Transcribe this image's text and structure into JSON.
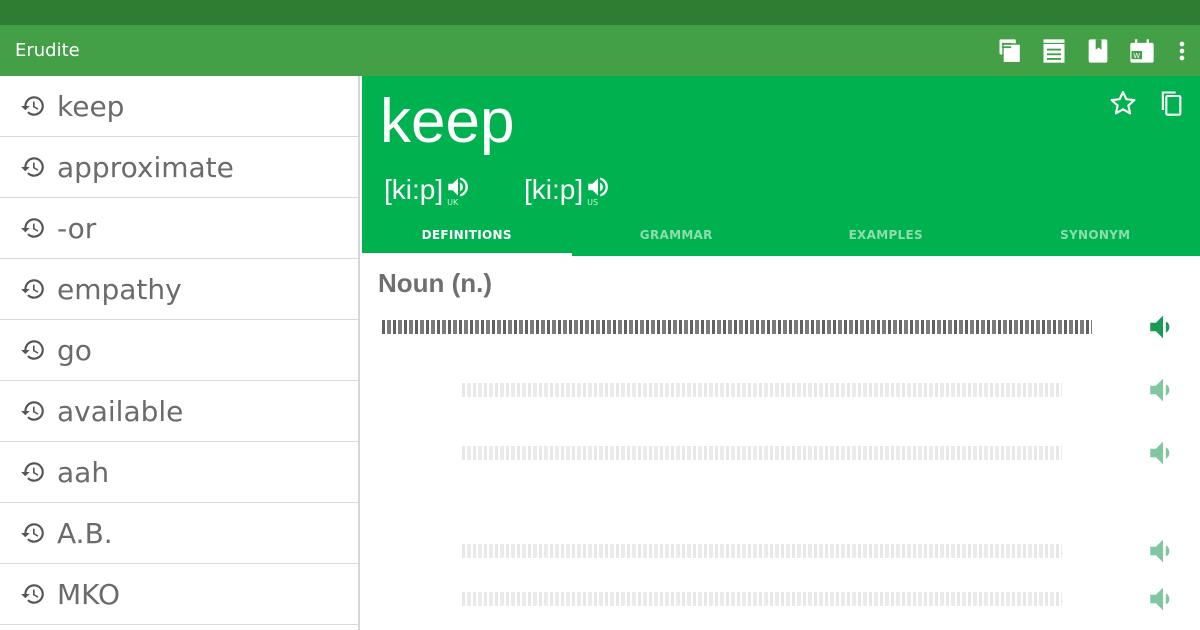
{
  "app": {
    "title": "Erudite"
  },
  "toolbar": {
    "icons": [
      "flashcards-icon",
      "archive-icon",
      "bookmark-icon",
      "word-of-day-icon",
      "more-vert-icon"
    ]
  },
  "history": {
    "items": [
      {
        "label": "keep"
      },
      {
        "label": "approximate"
      },
      {
        "label": "-or"
      },
      {
        "label": "empathy"
      },
      {
        "label": "go"
      },
      {
        "label": "available"
      },
      {
        "label": "aah"
      },
      {
        "label": "A.B."
      },
      {
        "label": "MKO"
      }
    ]
  },
  "entry": {
    "word": "keep",
    "pronunciations": [
      {
        "text": "[ki:p]",
        "region": "UK"
      },
      {
        "text": "[ki:p]",
        "region": "US"
      }
    ],
    "tabs": [
      {
        "label": "DEFINITIONS",
        "active": true
      },
      {
        "label": "GRAMMAR",
        "active": false
      },
      {
        "label": "EXAMPLES",
        "active": false
      },
      {
        "label": "SYNONYM",
        "active": false
      }
    ],
    "part_of_speech": "Noun (n.)"
  },
  "colors": {
    "status_bar": "#2e7d32",
    "app_bar": "#43a047",
    "hero": "#00b14f",
    "speaker": "#1a9a55"
  }
}
